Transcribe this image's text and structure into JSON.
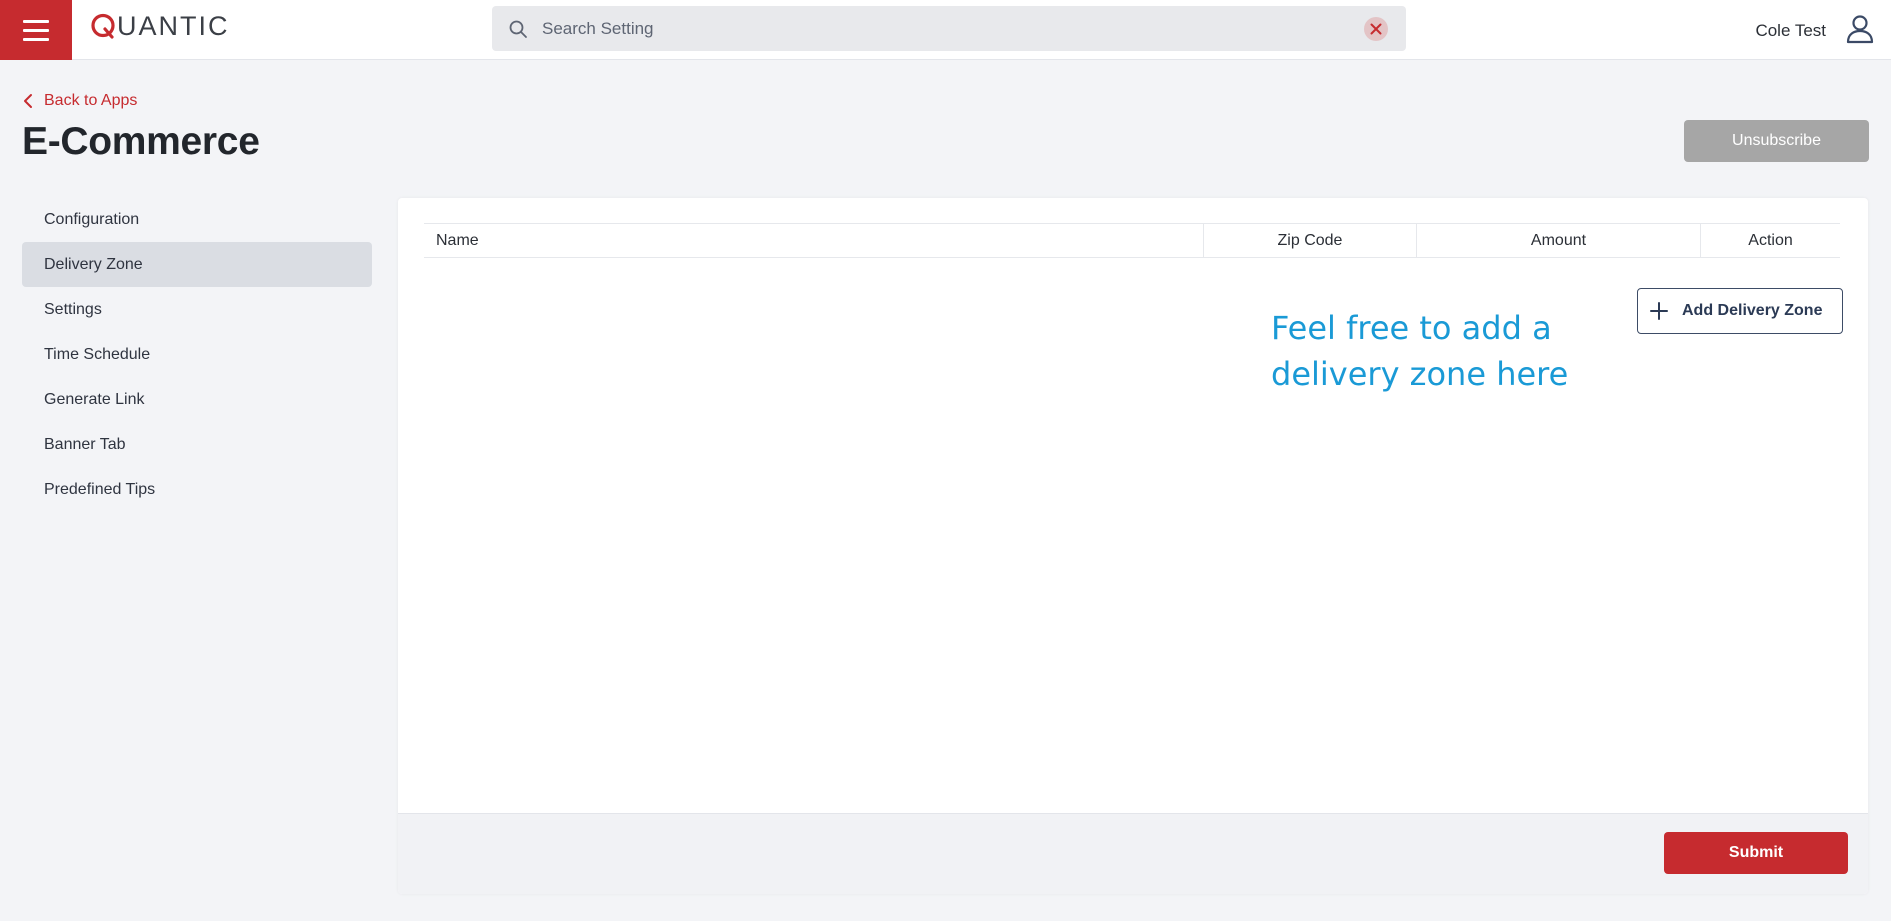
{
  "brand": {
    "logo_text": "UANTIC",
    "logo_full": "QUANTIC",
    "accent_color": "#c62b2f"
  },
  "search": {
    "placeholder": "Search Setting",
    "value": ""
  },
  "user": {
    "name": "Cole Test"
  },
  "header": {
    "back_label": "Back to Apps",
    "title": "E-Commerce",
    "unsubscribe_label": "Unsubscribe"
  },
  "sidebar": {
    "items": [
      {
        "label": "Configuration",
        "active": false
      },
      {
        "label": "Delivery Zone",
        "active": true
      },
      {
        "label": "Settings",
        "active": false
      },
      {
        "label": "Time Schedule",
        "active": false
      },
      {
        "label": "Generate Link",
        "active": false
      },
      {
        "label": "Banner Tab",
        "active": false
      },
      {
        "label": "Predefined Tips",
        "active": false
      }
    ]
  },
  "table": {
    "columns": [
      "Name",
      "Zip Code",
      "Amount",
      "Action"
    ],
    "rows": []
  },
  "main": {
    "add_button_label": "Add Delivery Zone",
    "annotation": "Feel free to add a delivery zone here",
    "annotation_color": "#1a9ad6",
    "submit_label": "Submit"
  },
  "icons": {
    "menu": "hamburger-menu-icon",
    "search": "search-icon",
    "clear": "close-icon",
    "user": "user-icon",
    "back": "chevron-left-icon",
    "add": "plus-icon"
  }
}
